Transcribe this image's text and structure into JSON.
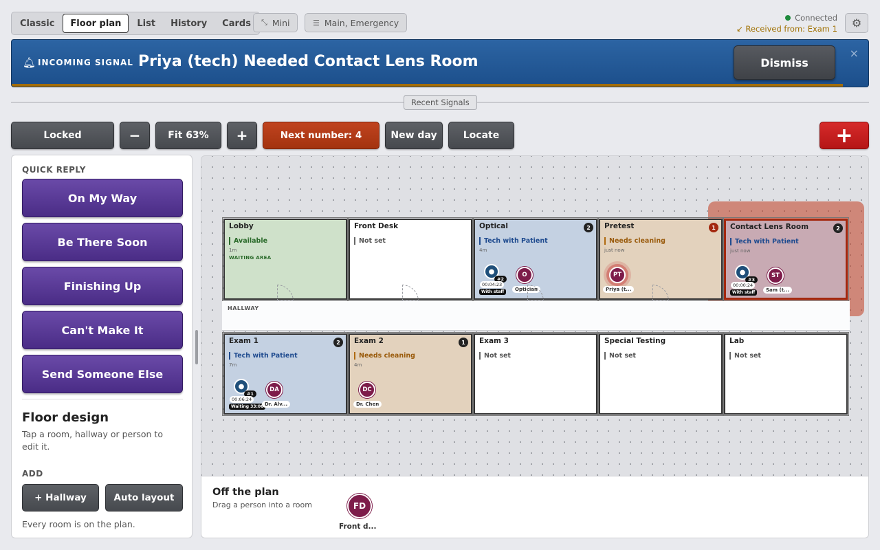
{
  "nav": {
    "tabs": [
      "Classic",
      "Floor plan",
      "List",
      "History",
      "Cards"
    ],
    "active_tab": "Floor plan",
    "mini_label": "Mini",
    "channels_label": "Main, Emergency"
  },
  "status": {
    "connection": "Connected",
    "received": "Received from: Exam 1"
  },
  "banner": {
    "tag": "INCOMING SIGNAL",
    "message": "Priya (tech) Needed Contact Lens Room",
    "dismiss_label": "Dismiss",
    "close": "×",
    "progress": 0.97
  },
  "recent_signals_label": "Recent Signals",
  "toolbar": {
    "lock_label": "Locked",
    "zoom_out": "−",
    "fit_label": "Fit 63%",
    "zoom_in": "+",
    "next_number_label": "Next number: 4",
    "new_day_label": "New day",
    "locate_label": "Locate",
    "emergency_label": "+"
  },
  "quick_reply": {
    "title": "QUICK REPLY",
    "buttons": [
      "On My Way",
      "Be There Soon",
      "Finishing Up",
      "Can't Make It",
      "Send Someone Else"
    ]
  },
  "floor_design": {
    "title": "Floor design",
    "description": "Tap a room, hallway or person to edit it.",
    "add_title": "ADD",
    "add_hallway": "+ Hallway",
    "auto_layout": "Auto layout",
    "footer": "Every room is on the plan."
  },
  "hallway_label": "HALLWAY",
  "rooms": [
    {
      "name": "Lobby",
      "status": "Available",
      "time": "1m",
      "area": "WAITING AREA",
      "count": ""
    },
    {
      "name": "Front Desk",
      "status": "Not set",
      "time": "",
      "count": ""
    },
    {
      "name": "Optical",
      "status": "Tech with Patient",
      "time": "4m",
      "count": "2"
    },
    {
      "name": "Pretest",
      "status": "Needs cleaning",
      "time": "just now",
      "count": "1"
    },
    {
      "name": "Contact Lens Room",
      "status": "Tech with Patient",
      "time": "just now",
      "count": "2"
    },
    {
      "name": "Exam 1",
      "status": "Tech with Patient",
      "time": "7m",
      "count": "2"
    },
    {
      "name": "Exam 2",
      "status": "Needs cleaning",
      "time": "4m",
      "count": "1"
    },
    {
      "name": "Exam 3",
      "status": "Not set",
      "time": "",
      "count": ""
    },
    {
      "name": "Special Testing",
      "status": "Not set",
      "time": "",
      "count": ""
    },
    {
      "name": "Lab",
      "status": "Not set",
      "time": "",
      "count": ""
    }
  ],
  "people": {
    "optical_patient": {
      "number": "#2",
      "timer": "00:04:23",
      "state": "With staff"
    },
    "optical_staff": {
      "initials": "O",
      "label": "Optician"
    },
    "pretest_staff": {
      "initials": "PT",
      "label": "Priya (t..."
    },
    "clr_patient": {
      "number": "#3",
      "timer": "00:00:24",
      "state": "With staff"
    },
    "clr_staff": {
      "initials": "ST",
      "label": "Sam (t..."
    },
    "exam1_patient": {
      "number": "#1",
      "timer": "00:06:24",
      "state": "Waiting 33:06"
    },
    "exam1_staff": {
      "initials": "DA",
      "label": "Dr. Alv..."
    },
    "exam2_staff": {
      "initials": "DC",
      "label": "Dr. Chen"
    }
  },
  "off_plan": {
    "title": "Off the plan",
    "description": "Drag a person into a room",
    "person_initials": "FD",
    "person_label": "Front d..."
  },
  "colors": {
    "banner": "#1c4f8b",
    "quick_reply": "#4a2c86",
    "alert": "#a3280f",
    "staff": "#7d1c4a",
    "patient": "#1f4f7a"
  }
}
